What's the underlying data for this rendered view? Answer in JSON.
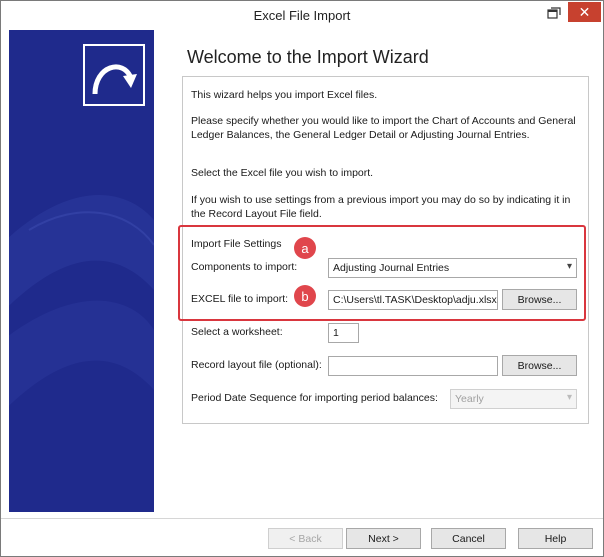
{
  "window": {
    "title": "Excel File Import"
  },
  "titlebar": {
    "restore_icon": "restore-icon",
    "close_icon": "close-icon",
    "close_glyph": "✕"
  },
  "heading": "Welcome to the Import Wizard",
  "intro": {
    "line1": "This wizard helps you import Excel files.",
    "line2": "Please specify whether you would like to import the Chart of Accounts and General Ledger Balances, the General Ledger Detail or Adjusting Journal Entries.",
    "line3": "Select the Excel file you wish to import.",
    "line4": "If you wish to use settings from a previous import you may do so by indicating it in the Record Layout File field."
  },
  "settings": {
    "group_label": "Import File Settings",
    "badge_a": "a",
    "badge_b": "b",
    "components_label": "Components to import:",
    "components_value": "Adjusting Journal Entries",
    "excel_label": "EXCEL file to import:",
    "excel_value": "C:\\Users\\tl.TASK\\Desktop\\adju.xlsx",
    "browse_label": "Browse..."
  },
  "worksheet": {
    "label": "Select a worksheet:",
    "value": "1"
  },
  "record_layout": {
    "label": "Record layout file (optional):",
    "value": "",
    "browse_label": "Browse..."
  },
  "period": {
    "label": "Period Date Sequence for importing period balances:",
    "value": "Yearly"
  },
  "footer": {
    "back": "< Back",
    "next": "Next >",
    "cancel": "Cancel",
    "help": "Help"
  },
  "colors": {
    "side_panel": "#1f2a8c",
    "highlight": "#d9363e",
    "badge": "#e0464c",
    "close_button": "#c7412f"
  }
}
